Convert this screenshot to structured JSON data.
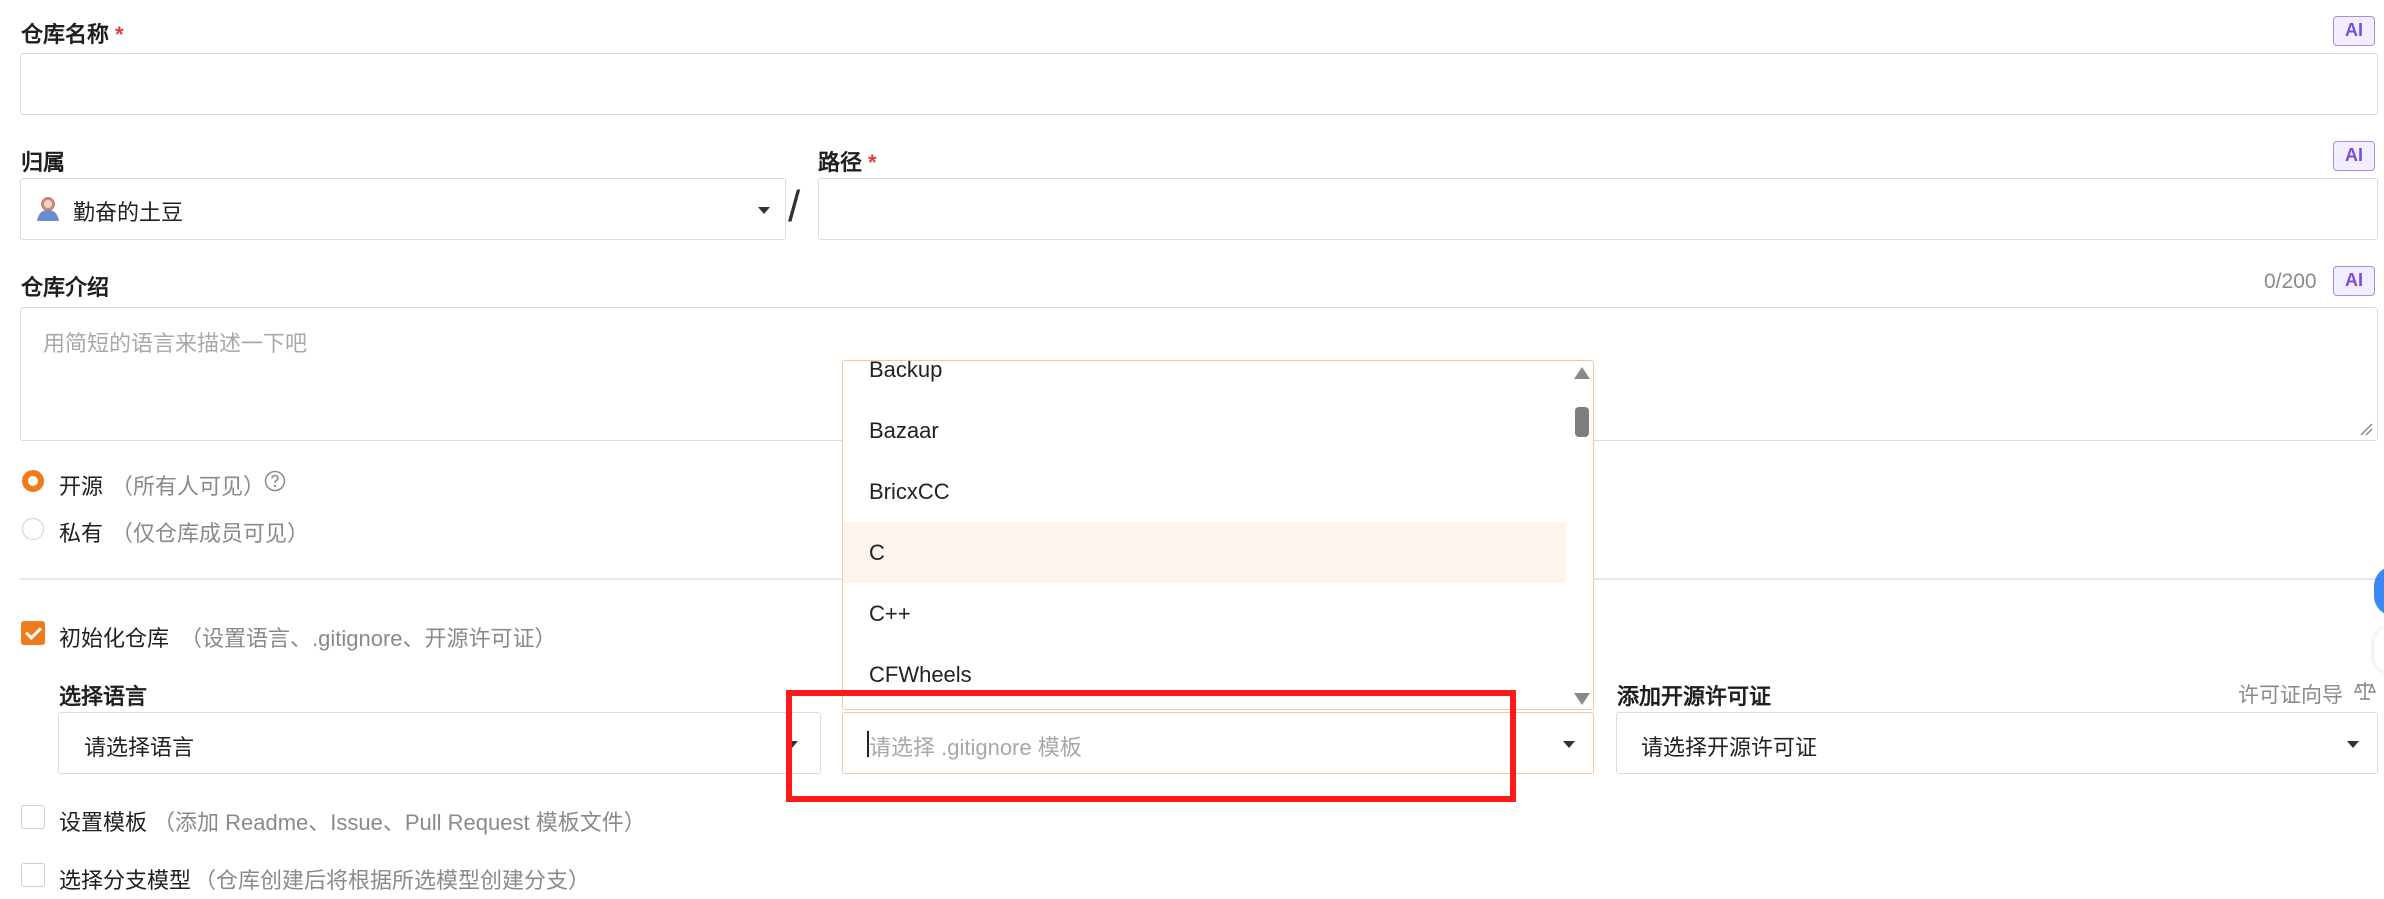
{
  "repo_name": {
    "label": "仓库名称",
    "required_mark": "*",
    "ai": "AI",
    "value": ""
  },
  "owner": {
    "label": "归属",
    "value": "勤奋的土豆",
    "separator": "/"
  },
  "path": {
    "label": "路径",
    "required_mark": "*",
    "ai": "AI",
    "value": ""
  },
  "description": {
    "label": "仓库介绍",
    "counter": "0/200",
    "ai": "AI",
    "placeholder": "用简短的语言来描述一下吧"
  },
  "visibility": {
    "selected": "开源",
    "options": [
      {
        "label": "开源",
        "hint": "（所有人可见）"
      },
      {
        "label": "私有",
        "hint": "（仅仓库成员可见）"
      }
    ]
  },
  "init": {
    "label": "初始化仓库",
    "hint": "（设置语言、.gitignore、开源许可证）",
    "checked": true
  },
  "language": {
    "label": "选择语言",
    "placeholder": "请选择语言"
  },
  "gitignore": {
    "placeholder": "请选择 .gitignore 模板",
    "options": [
      "Backup",
      "Bazaar",
      "BricxCC",
      "C",
      "C++",
      "CFWheels"
    ],
    "highlighted": "C"
  },
  "license": {
    "label": "添加开源许可证",
    "guide": "许可证向导",
    "placeholder": "请选择开源许可证"
  },
  "template": {
    "label": "设置模板",
    "hint": "（添加 Readme、Issue、Pull Request 模板文件）"
  },
  "branch_model": {
    "label": "选择分支模型",
    "hint": "（仓库创建后将根据所选模型创建分支）"
  },
  "colors": {
    "accent": "#f07b1d",
    "highlight_box": "#ff1a1a",
    "ai_badge": "#7a4be0"
  }
}
